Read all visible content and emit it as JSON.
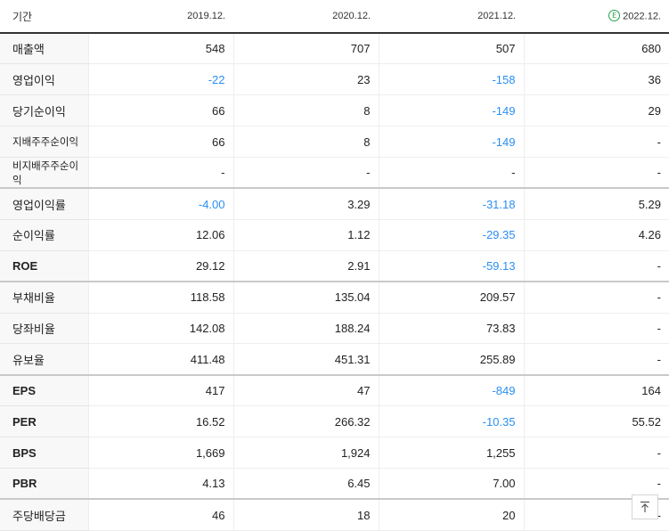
{
  "header": {
    "period_label": "기간",
    "periods": [
      "2019.12.",
      "2020.12.",
      "2021.12.",
      "2022.12."
    ],
    "estimate_badge": "E"
  },
  "rows": [
    {
      "label": "매출액",
      "values": [
        "548",
        "707",
        "507",
        "680"
      ]
    },
    {
      "label": "영업이익",
      "values": [
        "-22",
        "23",
        "-158",
        "36"
      ]
    },
    {
      "label": "당기순이익",
      "values": [
        "66",
        "8",
        "-149",
        "29"
      ]
    },
    {
      "label": "지배주주순이익",
      "values": [
        "66",
        "8",
        "-149",
        "-"
      ]
    },
    {
      "label": "비지배주주순이익",
      "values": [
        "-",
        "-",
        "-",
        "-"
      ]
    },
    {
      "label": "영업이익률",
      "values": [
        "-4.00",
        "3.29",
        "-31.18",
        "5.29"
      ]
    },
    {
      "label": "순이익률",
      "values": [
        "12.06",
        "1.12",
        "-29.35",
        "4.26"
      ]
    },
    {
      "label": "ROE",
      "values": [
        "29.12",
        "2.91",
        "-59.13",
        "-"
      ]
    },
    {
      "label": "부채비율",
      "values": [
        "118.58",
        "135.04",
        "209.57",
        "-"
      ]
    },
    {
      "label": "당좌비율",
      "values": [
        "142.08",
        "188.24",
        "73.83",
        "-"
      ]
    },
    {
      "label": "유보율",
      "values": [
        "411.48",
        "451.31",
        "255.89",
        "-"
      ]
    },
    {
      "label": "EPS",
      "values": [
        "417",
        "47",
        "-849",
        "164"
      ]
    },
    {
      "label": "PER",
      "values": [
        "16.52",
        "266.32",
        "-10.35",
        "55.52"
      ]
    },
    {
      "label": "BPS",
      "values": [
        "1,669",
        "1,924",
        "1,255",
        "-"
      ]
    },
    {
      "label": "PBR",
      "values": [
        "4.13",
        "6.45",
        "7.00",
        "-"
      ]
    },
    {
      "label": "주당배당금",
      "values": [
        "46",
        "18",
        "20",
        "-"
      ]
    }
  ],
  "colors": {
    "negative": "#2a8ff1",
    "estimate_badge": "#25a14a",
    "header_rule": "#333333"
  },
  "icons": {
    "scroll_top": "arrow-up-to-line-icon"
  }
}
